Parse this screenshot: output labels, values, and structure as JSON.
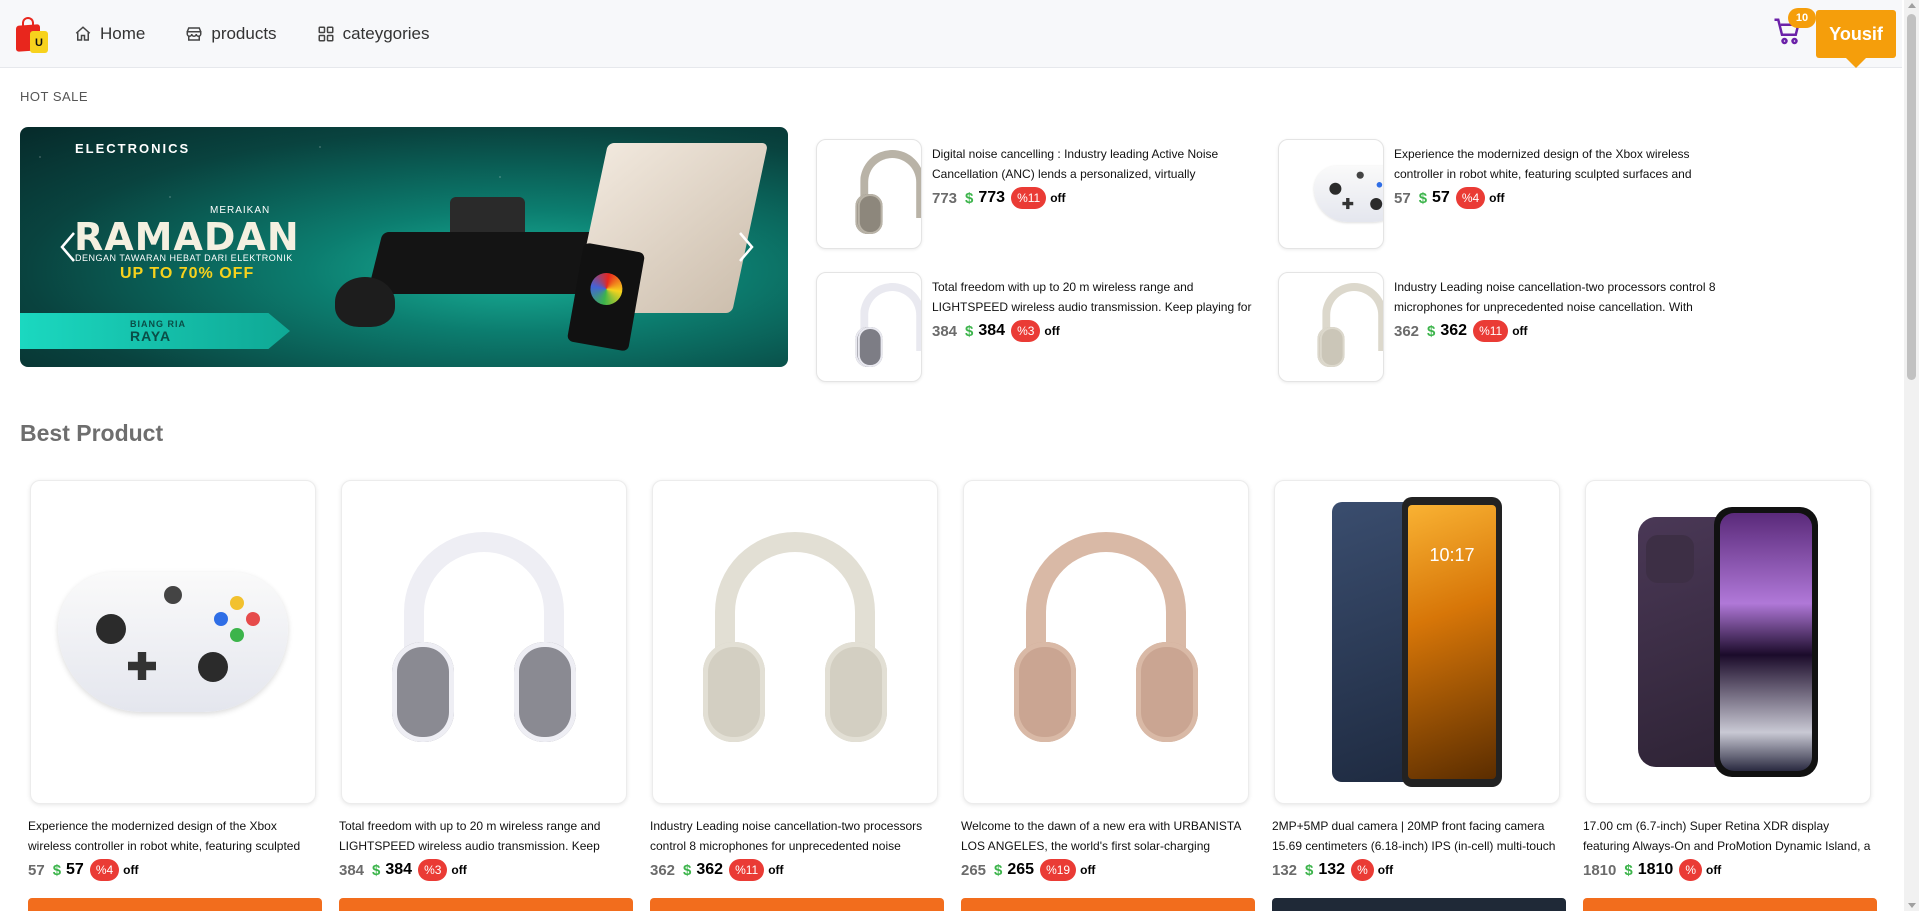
{
  "nav": {
    "home": "Home",
    "products": "products",
    "categories": "cateygories",
    "cart_count": "10",
    "user": "Yousif"
  },
  "hot_sale": {
    "title": "HOT SALE",
    "banner": {
      "category": "ELECTRONICS",
      "line1": "MERAIKAN",
      "headline": "RAMADAN",
      "line2": "DENGAN TAWARAN HEBAT DARI ELEKTRONIK",
      "line3": "UP TO 70% OFF",
      "ribbon1": "BIANG RIA",
      "ribbon2": "RAYA"
    },
    "items": [
      {
        "desc": "Digital noise cancelling : Industry leading Active Noise Cancellation (ANC) lends a personalized, virtually",
        "old": "773",
        "currency": "$",
        "new": "773",
        "discount": "%11",
        "off": "off",
        "icon": "headphones-silver"
      },
      {
        "desc": "Experience the modernized design of the Xbox wireless controller in robot white, featuring sculpted surfaces and",
        "old": "57",
        "currency": "$",
        "new": "57",
        "discount": "%4",
        "off": "off",
        "icon": "xbox-controller"
      },
      {
        "desc": "Total freedom with up to 20 m wireless range and LIGHTSPEED wireless audio transmission. Keep playing for",
        "old": "384",
        "currency": "$",
        "new": "384",
        "discount": "%3",
        "off": "off",
        "icon": "gaming-headset"
      },
      {
        "desc": "Industry Leading noise cancellation-two processors control 8 microphones for unprecedented noise cancellation. With",
        "old": "362",
        "currency": "$",
        "new": "362",
        "discount": "%11",
        "off": "off",
        "icon": "headphones-cream"
      }
    ]
  },
  "best": {
    "title": "Best Product",
    "products": [
      {
        "desc": "Experience the modernized design of the Xbox wireless controller in robot white, featuring sculpted",
        "old": "57",
        "currency": "$",
        "new": "57",
        "discount": "%4",
        "off": "off",
        "icon": "xbox-controller"
      },
      {
        "desc": "Total freedom with up to 20 m wireless range and LIGHTSPEED wireless audio transmission. Keep",
        "old": "384",
        "currency": "$",
        "new": "384",
        "discount": "%3",
        "off": "off",
        "icon": "gaming-headset"
      },
      {
        "desc": "Industry Leading noise cancellation-two processors control 8 microphones for unprecedented noise",
        "old": "362",
        "currency": "$",
        "new": "362",
        "discount": "%11",
        "off": "off",
        "icon": "headphones-cream"
      },
      {
        "desc": "Welcome to the dawn of a new era with URBANISTA LOS ANGELES, the world's first solar-charging",
        "old": "265",
        "currency": "$",
        "new": "265",
        "discount": "%19",
        "off": "off",
        "icon": "headphones-rose"
      },
      {
        "desc": "2MP+5MP dual camera | 20MP front facing camera 15.69 centimeters (6.18-inch) IPS (in-cell) multi-touch",
        "old": "132",
        "currency": "$",
        "new": "132",
        "discount": "%",
        "off": "off",
        "icon": "android-phone",
        "screen_time": "10:17"
      },
      {
        "desc": "17.00 cm (6.7-inch) Super Retina XDR display featuring Always-On and ProMotion Dynamic Island, a",
        "old": "1810",
        "currency": "$",
        "new": "1810",
        "discount": "%",
        "off": "off",
        "icon": "iphone"
      }
    ]
  },
  "colors": {
    "accent": "#f59e0b",
    "button": "#f26d1d",
    "button_dark": "#1f2937",
    "discount": "#ea3b35",
    "currency": "#3cb44b"
  }
}
